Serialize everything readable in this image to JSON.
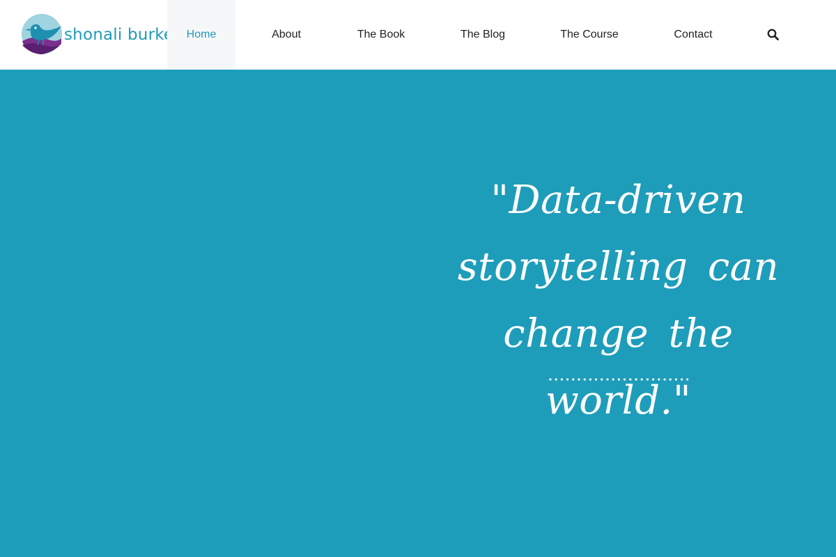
{
  "brand": {
    "name": "shonali burke",
    "color": "#1f9bb9"
  },
  "nav": {
    "items": [
      {
        "label": "Home",
        "active": true
      },
      {
        "label": "About",
        "active": false
      },
      {
        "label": "The Book",
        "active": false
      },
      {
        "label": "The Blog",
        "active": false
      },
      {
        "label": "The Course",
        "active": false
      },
      {
        "label": "Contact",
        "active": false
      }
    ],
    "search_icon": "search-icon"
  },
  "hero": {
    "background": "#1e9dba",
    "quote": "\"Data-driven storytelling can change the world.\"",
    "divider": "dotted-divider"
  }
}
